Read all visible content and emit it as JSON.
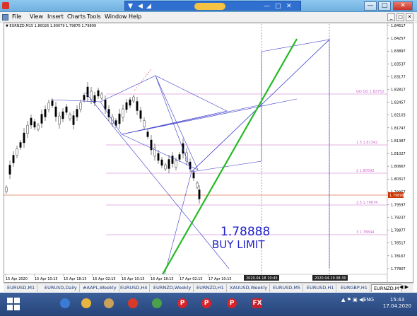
{
  "window": {
    "title_controls": [
      "▼",
      "◀",
      "◢"
    ],
    "title_right_controls": [
      "—",
      "□",
      "✕"
    ]
  },
  "menu": {
    "items": [
      "File",
      "View",
      "Insert",
      "Charts",
      "Tools",
      "Window",
      "Help"
    ],
    "mdi_controls": [
      "_",
      "□",
      "✕"
    ]
  },
  "chart": {
    "header_line": "▼ EURNZD,M15  1.80026 1.80079 1.79876 1.79899",
    "price_labels": [
      "1.84617",
      "1.84257",
      "1.83897",
      "1.83537",
      "1.83177",
      "1.82817",
      "1.82457",
      "1.82103",
      "1.81747",
      "1.81387",
      "1.81027",
      "1.80667",
      "1.80317",
      "1.79957",
      "1.79597",
      "1.79237",
      "1.78877",
      "1.78517",
      "1.78167",
      "1.77807"
    ],
    "current_price": "1.79899",
    "time_labels": [
      "15 Apr 2020",
      "15 Apr 10:15",
      "15 Apr 18:15",
      "16 Apr 02:15",
      "16 Apr 10:15",
      "16 Apr 18:15",
      "17 Apr 02:15",
      "17 Apr 10:15"
    ],
    "time_markers": [
      "2020.04.18 10:45",
      "2020.04.19 08:30"
    ],
    "fib_labels": [
      "GO GO 1.82752",
      "1.5  1.81342",
      "2  1.80592",
      "2.5  1.79674",
      "3  1.78844"
    ],
    "annotation_price": "1.78888",
    "annotation_text": "BUY LIMIT",
    "colors": {
      "background": "#ffffff",
      "candles": "#000000",
      "trend_lines": "#3a3acc",
      "fib_lines": "#cc66cc",
      "green_line": "#22bb22",
      "current_price_line": "#cc3300",
      "annotation": "#2222cc"
    }
  },
  "tabs": {
    "items": [
      "EURUSD,M1",
      "EURUSD,Daily",
      "#AAPL,Weekly",
      "EURUSD,H4",
      "EURNZD,Weekly",
      "EURNZD,H1",
      "XAUUSD,Weekly",
      "EURUSD,M5",
      "EURUSD,H1",
      "EURGBP,H1",
      "EURNZD,M"
    ],
    "nav": "◀ ▶"
  },
  "taskbar": {
    "lang": "ENG",
    "time": "15:43",
    "date": "17.04.2020",
    "apps": [
      {
        "icon": "metatrader-icon",
        "color": "#3a7bd5"
      },
      {
        "icon": "folder-icon",
        "color": "#e8b640"
      },
      {
        "icon": "broom-icon",
        "color": "#c9a15a"
      },
      {
        "icon": "puzzle-icon",
        "color": "#d83a2a"
      },
      {
        "icon": "color-palette-icon",
        "color": "#4aa24a"
      },
      {
        "icon": "p-app-icon-1",
        "color": "#d8232a"
      },
      {
        "icon": "p-app-icon-2",
        "color": "#d8232a"
      },
      {
        "icon": "p-app-icon-3",
        "color": "#d8232a"
      },
      {
        "icon": "fx-app-icon",
        "color": "#c8202a"
      }
    ],
    "p_letter": "P",
    "fx_label": "FX"
  }
}
